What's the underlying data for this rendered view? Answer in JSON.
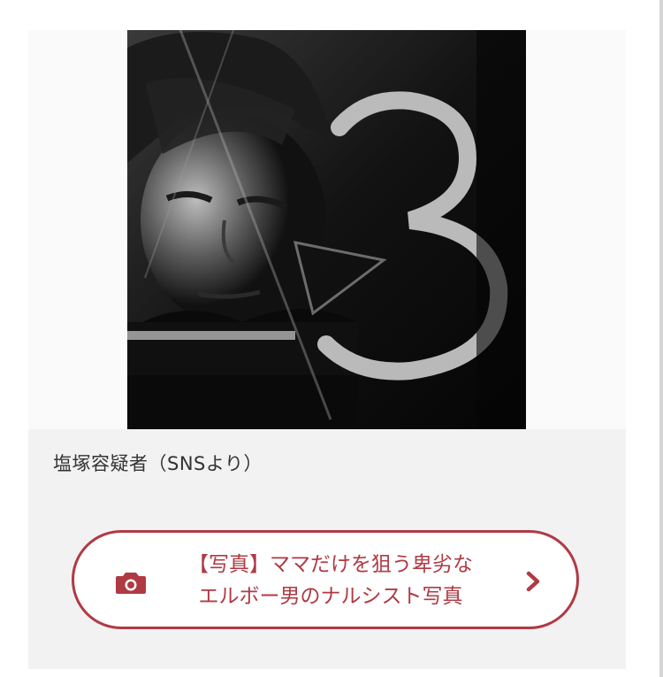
{
  "figure": {
    "photo_alt": "写真",
    "caption": "塩塚容疑者（SNSより）"
  },
  "related_link": {
    "icon": "camera-icon",
    "line1": "【写真】ママだけを狙う卑劣な",
    "line2": "エルボー男のナルシスト写真",
    "arrow_icon": "chevron-right-icon"
  },
  "colors": {
    "accent": "#b03a44",
    "figure_background": "#f2f2f2",
    "caption_text": "#333333"
  }
}
